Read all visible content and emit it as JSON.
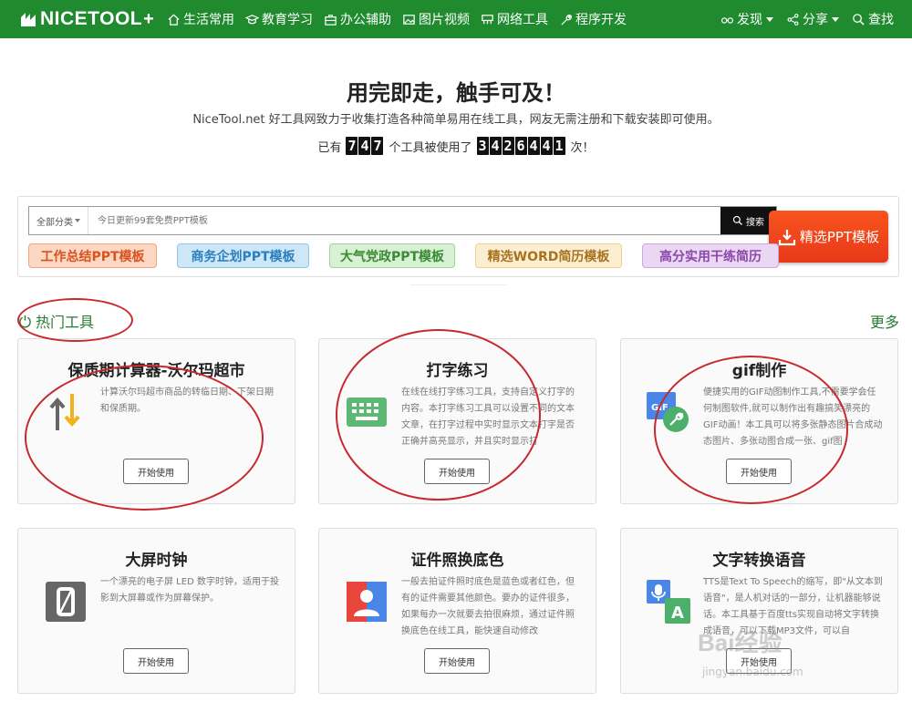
{
  "nav": {
    "logo_text": "NICETOOL",
    "logo_plus": "+",
    "items": [
      {
        "label": "生活常用",
        "icon": "home-icon"
      },
      {
        "label": "教育学习",
        "icon": "graduation-icon"
      },
      {
        "label": "办公辅助",
        "icon": "briefcase-icon"
      },
      {
        "label": "图片视频",
        "icon": "image-icon"
      },
      {
        "label": "网络工具",
        "icon": "network-icon"
      },
      {
        "label": "程序开发",
        "icon": "wrench-icon"
      }
    ],
    "right": [
      {
        "label": "发现",
        "icon": "glasses-icon"
      },
      {
        "label": "分享",
        "icon": "share-icon"
      },
      {
        "label": "查找",
        "icon": "search-icon"
      }
    ]
  },
  "hero": {
    "title": "用完即走，触手可及！",
    "subtitle": "NiceTool.net 好工具网致力于收集打造各种简单易用在线工具，网友无需注册和下载安装即可使用。",
    "stats_prefix": "已有",
    "tool_count": "747",
    "stats_middle": "个工具被使用了",
    "use_count": "3426441",
    "stats_suffix": "次！"
  },
  "search": {
    "category": "全部分类",
    "placeholder": "今日更新99套免费PPT模板",
    "button": "搜索",
    "ppt_button": "精选PPT模板"
  },
  "tags": [
    {
      "label": "工作总结PPT模板",
      "bg": "#fbd7c4",
      "border": "#f4a47f",
      "color": "#d9531e",
      "width": 141
    },
    {
      "label": "商务企划PPT模板",
      "bg": "#cde7f7",
      "border": "#8cc6ec",
      "color": "#2a7fc0",
      "width": 145
    },
    {
      "label": "大气党政PPT模板",
      "bg": "#d8f0d4",
      "border": "#9fd497",
      "color": "#3b8a34",
      "width": 138
    },
    {
      "label": "精选WORD简历模板",
      "bg": "#fbeed2",
      "border": "#f0cf8a",
      "color": "#a9731e",
      "width": 161
    },
    {
      "label": "高分实用干练简历",
      "bg": "#ead8f2",
      "border": "#cfa6e1",
      "color": "#8c47ad",
      "width": 150
    }
  ],
  "section": {
    "title": "热门工具",
    "more": "更多"
  },
  "cards": [
    {
      "title": "保质期计算器-沃尔玛超市",
      "desc": "计算沃尔玛超市商品的转临日期、下架日期和保质期。",
      "button": "开始使用",
      "icon": "sort-arrows-icon"
    },
    {
      "title": "打字练习",
      "desc": "在线在线打字练习工具，支持自定义打字的内容。本打字练习工具可以设置不同的文本文章，在打字过程中实时显示文本打字是否正确并高亮显示，并且实时显示打",
      "button": "开始使用",
      "icon": "keyboard-icon"
    },
    {
      "title": "gif制作",
      "desc": "便捷实用的GIF动图制作工具,不需要学会任何制图软件,就可以制作出有趣搞笑漂亮的GIF动画！本工具可以将多张静态图片合成动态图片、多张动图合成一张、gif图",
      "button": "开始使用",
      "icon": "gif-tool-icon"
    },
    {
      "title": "大屏时钟",
      "desc": "一个漂亮的电子屏 LED 数字时钟，适用于投影到大屏幕或作为屏幕保护。",
      "button": "开始使用",
      "icon": "led-digit-icon"
    },
    {
      "title": "证件照换底色",
      "desc": "一般去拍证件照时底色是蓝色或者红色，但有的证件需要其他颜色。要办的证件很多，如果每办一次就要去拍很麻烦，通过证件照换底色在线工具，能快速自动修改",
      "button": "开始使用",
      "icon": "id-photo-icon"
    },
    {
      "title": "文字转换语音",
      "desc": "TTS是Text To Speech的缩写，即\"从文本到语音\"，是人机对话的一部分，让机器能够说话。本工具基于百度tts实现自动将文字转换成语音，可以下载MP3文件，可以自",
      "button": "开始使用",
      "icon": "text-to-speech-icon"
    }
  ],
  "watermark": {
    "text": "Bai经验",
    "url": "jingyan.baidu.com"
  }
}
